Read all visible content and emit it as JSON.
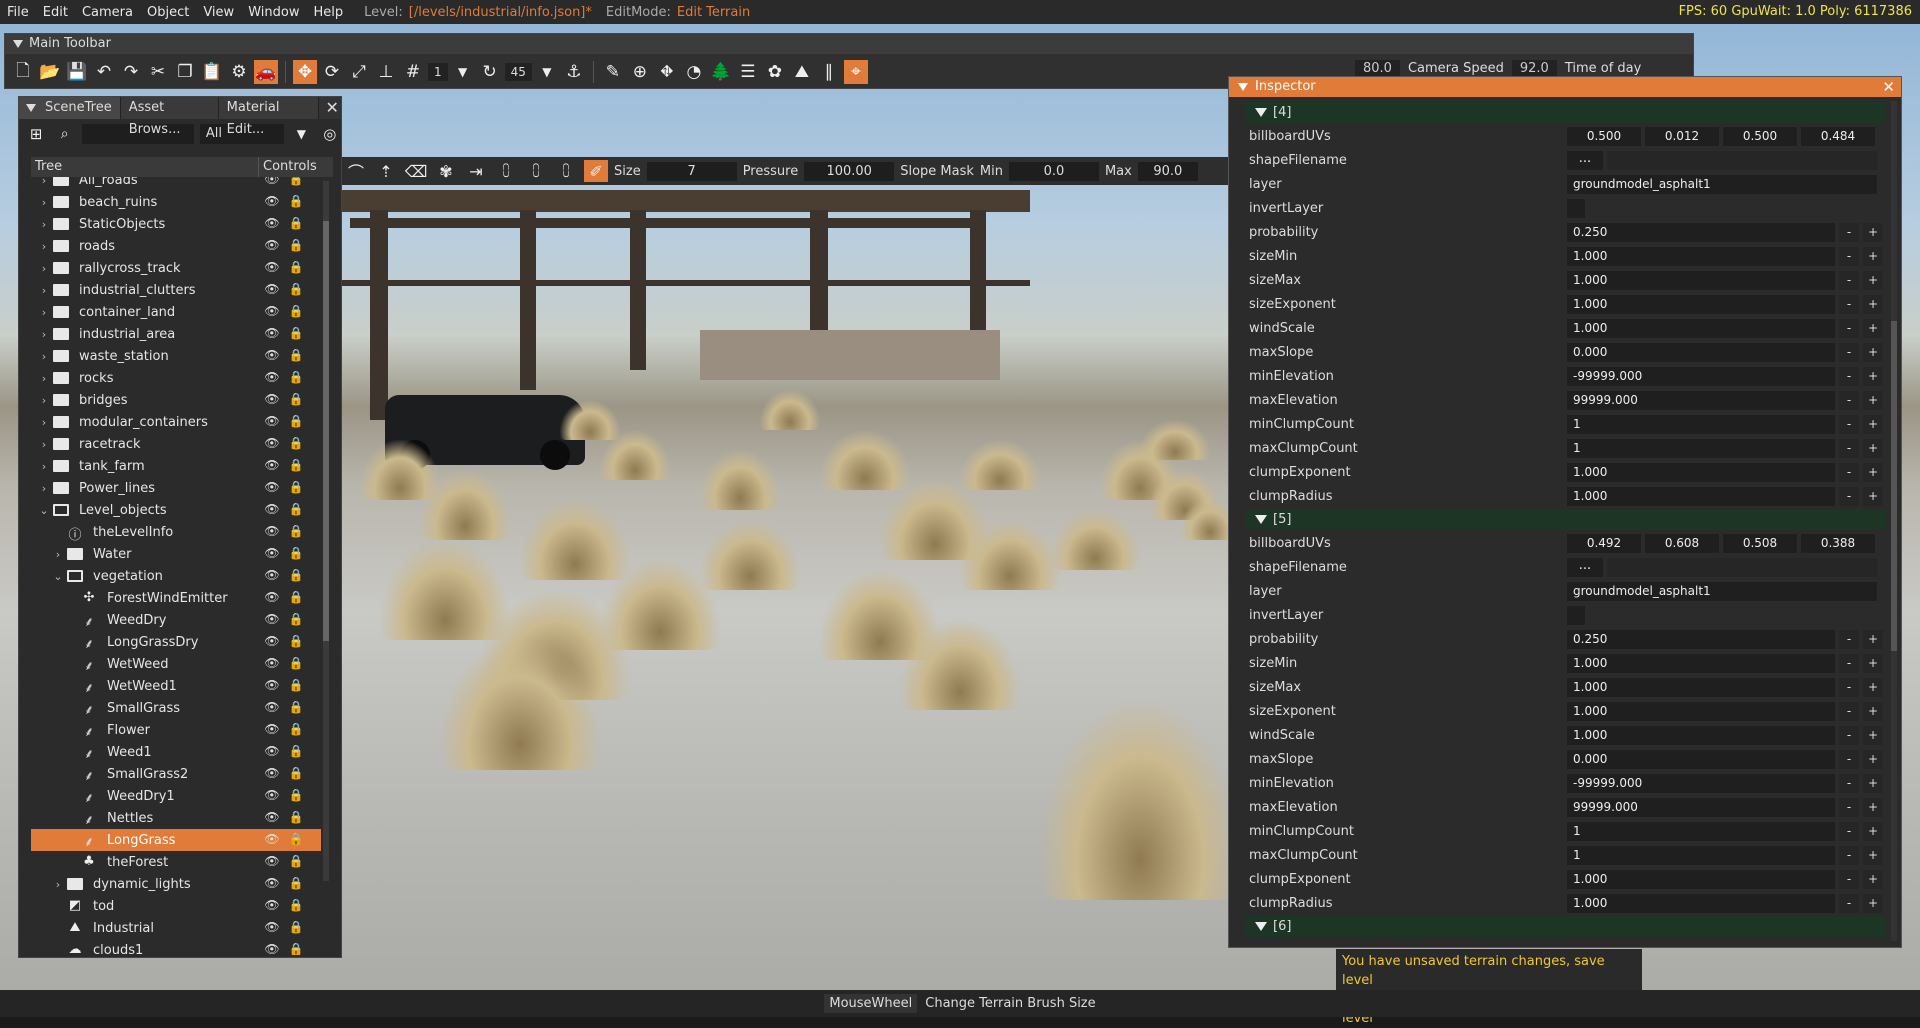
{
  "menu": [
    "File",
    "Edit",
    "Camera",
    "Object",
    "View",
    "Window",
    "Help"
  ],
  "level_label": "Level:",
  "level_path": "[/levels/industrial/info.json]*",
  "editmode_label": "EditMode:",
  "editmode_value": "Edit Terrain",
  "stats": "FPS: 60  GpuWait: 1.0  Poly: 6117386",
  "main_toolbar": {
    "title": "Main Toolbar",
    "num1": "1",
    "num2": "45",
    "camera_speed_label": "Camera Speed",
    "camera_speed_value": "92.0",
    "first_value": "80.0",
    "time_of_day_label": "Time of day"
  },
  "brush": {
    "size_label": "Size",
    "size_value": "7",
    "pressure_label": "Pressure",
    "pressure_value": "100.00",
    "slope_label": "Slope Mask",
    "min_label": "Min",
    "min_value": "0.0",
    "max_label": "Max",
    "max_value": "90.0"
  },
  "scene": {
    "tabs": [
      "SceneTree",
      "Asset Brows...",
      "Material Edit..."
    ],
    "filter": "All",
    "col_tree": "Tree",
    "col_controls": "Controls",
    "rows": [
      {
        "name": "All_roads",
        "depth": 0,
        "icon": "folder",
        "expand": true
      },
      {
        "name": "beach_ruins",
        "depth": 0,
        "icon": "folder",
        "expand": true
      },
      {
        "name": "StaticObjects",
        "depth": 0,
        "icon": "folder",
        "expand": true
      },
      {
        "name": "roads",
        "depth": 0,
        "icon": "folder",
        "expand": true
      },
      {
        "name": "rallycross_track",
        "depth": 0,
        "icon": "folder",
        "expand": true
      },
      {
        "name": "industrial_clutters",
        "depth": 0,
        "icon": "folder",
        "expand": true
      },
      {
        "name": "container_land",
        "depth": 0,
        "icon": "folder",
        "expand": true
      },
      {
        "name": "industrial_area",
        "depth": 0,
        "icon": "folder",
        "expand": true
      },
      {
        "name": "waste_station",
        "depth": 0,
        "icon": "folder",
        "expand": true
      },
      {
        "name": "rocks",
        "depth": 0,
        "icon": "folder",
        "expand": true
      },
      {
        "name": "bridges",
        "depth": 0,
        "icon": "folder",
        "expand": true
      },
      {
        "name": "modular_containers",
        "depth": 0,
        "icon": "folder",
        "expand": true
      },
      {
        "name": "racetrack",
        "depth": 0,
        "icon": "folder",
        "expand": true
      },
      {
        "name": "tank_farm",
        "depth": 0,
        "icon": "folder",
        "expand": true
      },
      {
        "name": "Power_lines",
        "depth": 0,
        "icon": "folder",
        "expand": true
      },
      {
        "name": "Level_objects",
        "depth": 0,
        "icon": "folder-open",
        "expanded": true
      },
      {
        "name": "theLevelInfo",
        "depth": 1,
        "icon": "info"
      },
      {
        "name": "Water",
        "depth": 1,
        "icon": "folder",
        "expand": true
      },
      {
        "name": "vegetation",
        "depth": 1,
        "icon": "folder-open",
        "expanded": true
      },
      {
        "name": "ForestWindEmitter",
        "depth": 2,
        "icon": "fan"
      },
      {
        "name": "WeedDry",
        "depth": 2,
        "icon": "plant"
      },
      {
        "name": "LongGrassDry",
        "depth": 2,
        "icon": "plant"
      },
      {
        "name": "WetWeed",
        "depth": 2,
        "icon": "plant"
      },
      {
        "name": "WetWeed1",
        "depth": 2,
        "icon": "plant"
      },
      {
        "name": "SmallGrass",
        "depth": 2,
        "icon": "plant"
      },
      {
        "name": "Flower",
        "depth": 2,
        "icon": "plant"
      },
      {
        "name": "Weed1",
        "depth": 2,
        "icon": "plant"
      },
      {
        "name": "SmallGrass2",
        "depth": 2,
        "icon": "plant"
      },
      {
        "name": "WeedDry1",
        "depth": 2,
        "icon": "plant"
      },
      {
        "name": "Nettles",
        "depth": 2,
        "icon": "plant"
      },
      {
        "name": "LongGrass",
        "depth": 2,
        "icon": "plant",
        "selected": true
      },
      {
        "name": "theForest",
        "depth": 2,
        "icon": "forest"
      },
      {
        "name": "dynamic_lights",
        "depth": 1,
        "icon": "folder",
        "expand": true
      },
      {
        "name": "tod",
        "depth": 1,
        "icon": "tod"
      },
      {
        "name": "Industrial",
        "depth": 1,
        "icon": "terrain"
      },
      {
        "name": "clouds1",
        "depth": 1,
        "icon": "cloud"
      }
    ]
  },
  "inspector": {
    "title": "Inspector",
    "sections": [
      {
        "label": "[4]",
        "uvs": [
          "0.500",
          "0.012",
          "0.500",
          "0.484"
        ],
        "layer": "groundmodel_asphalt1",
        "props": [
          [
            "probability",
            "0.250"
          ],
          [
            "sizeMin",
            "1.000"
          ],
          [
            "sizeMax",
            "1.000"
          ],
          [
            "sizeExponent",
            "1.000"
          ],
          [
            "windScale",
            "1.000"
          ],
          [
            "maxSlope",
            "0.000"
          ],
          [
            "minElevation",
            "-99999.000"
          ],
          [
            "maxElevation",
            "99999.000"
          ],
          [
            "minClumpCount",
            "1"
          ],
          [
            "maxClumpCount",
            "1"
          ],
          [
            "clumpExponent",
            "1.000"
          ],
          [
            "clumpRadius",
            "1.000"
          ]
        ]
      },
      {
        "label": "[5]",
        "uvs": [
          "0.492",
          "0.608",
          "0.508",
          "0.388"
        ],
        "layer": "groundmodel_asphalt1",
        "props": [
          [
            "probability",
            "0.250"
          ],
          [
            "sizeMin",
            "1.000"
          ],
          [
            "sizeMax",
            "1.000"
          ],
          [
            "sizeExponent",
            "1.000"
          ],
          [
            "windScale",
            "1.000"
          ],
          [
            "maxSlope",
            "0.000"
          ],
          [
            "minElevation",
            "-99999.000"
          ],
          [
            "maxElevation",
            "99999.000"
          ],
          [
            "minClumpCount",
            "1"
          ],
          [
            "maxClumpCount",
            "1"
          ],
          [
            "clumpExponent",
            "1.000"
          ],
          [
            "clumpRadius",
            "1.000"
          ]
        ]
      },
      {
        "label": "[6]",
        "uvs": [],
        "layer": "",
        "props": []
      }
    ],
    "lbl_uvs": "billboardUVs",
    "lbl_shape": "shapeFilename",
    "lbl_layer": "layer",
    "lbl_invert": "invertLayer",
    "dots": "...",
    "minus": "-",
    "plus": "+"
  },
  "toast": [
    "You have unsaved terrain changes, save level",
    "You have unsaved material changes, save level"
  ],
  "status": {
    "key": "MouseWheel",
    "action": "Change Terrain Brush Size"
  },
  "colors": {
    "accent": "#e07b39",
    "fps": "#f0e24a",
    "warn": "#f0c830"
  }
}
